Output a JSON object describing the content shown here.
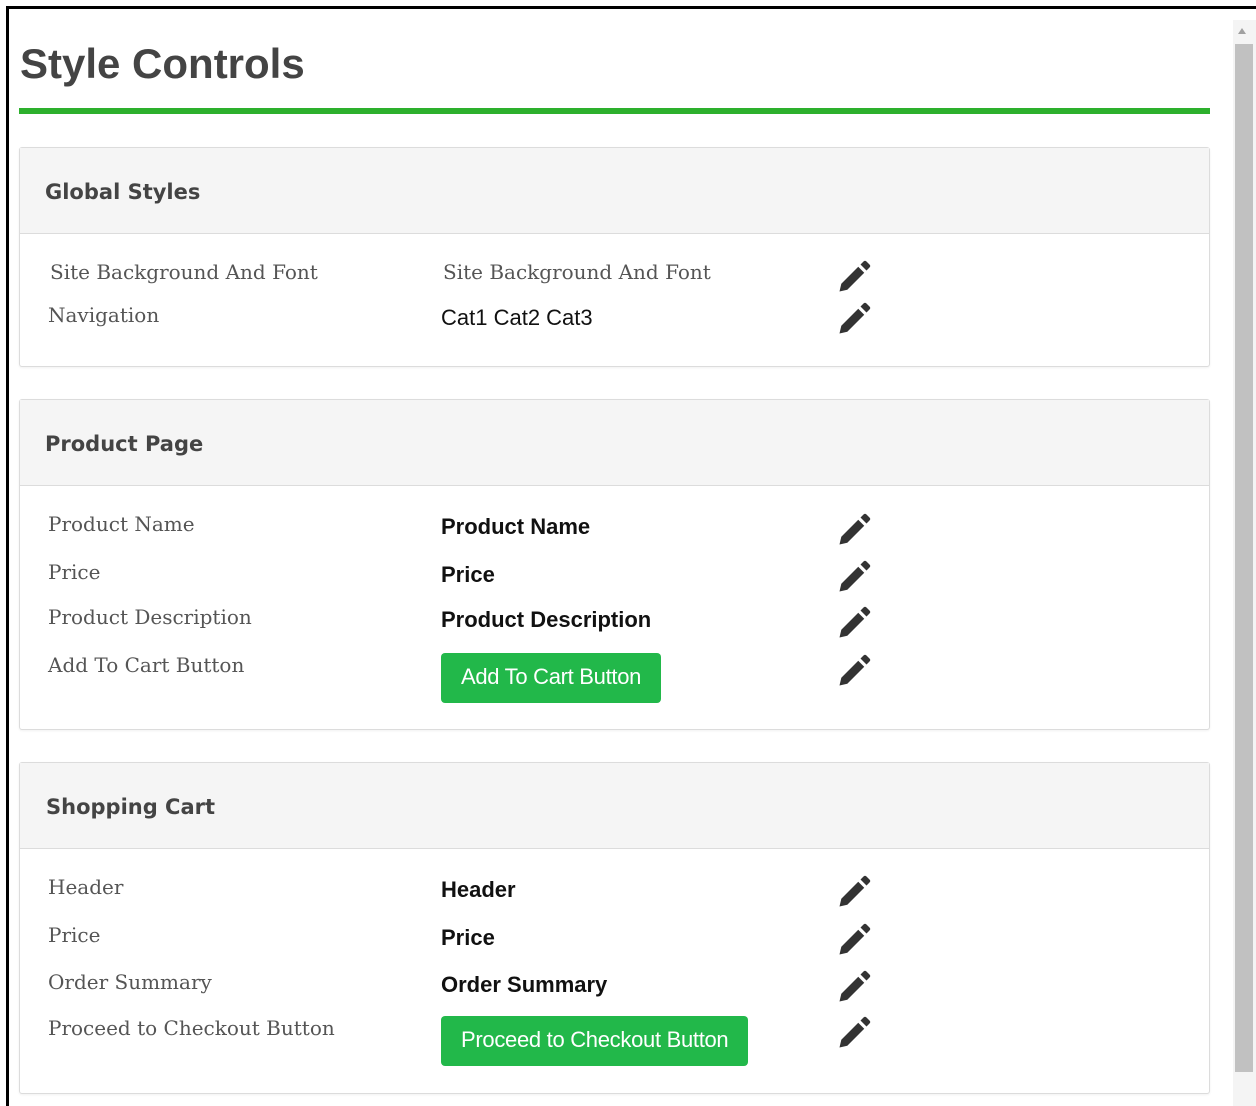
{
  "page_title": "Style Controls",
  "colors": {
    "accent_rule": "#2db02d",
    "button_green": "#22b84a",
    "panel_header_bg": "#f5f5f5"
  },
  "sections": [
    {
      "title": "Global Styles",
      "rows": [
        {
          "label": "Site Background And Font",
          "preview": "Site Background And Font",
          "preview_style": "serif",
          "icon": "pencil-icon"
        },
        {
          "label": "Navigation",
          "preview": "Cat1 Cat2 Cat3",
          "preview_style": "plain",
          "icon": "pencil-icon"
        }
      ]
    },
    {
      "title": "Product Page",
      "rows": [
        {
          "label": "Product Name",
          "preview": "Product Name",
          "preview_style": "bold",
          "icon": "pencil-icon"
        },
        {
          "label": "Price",
          "preview": "Price",
          "preview_style": "bold",
          "icon": "pencil-icon"
        },
        {
          "label": "Product Description",
          "preview": "Product Description",
          "preview_style": "bold",
          "icon": "pencil-icon"
        },
        {
          "label": "Add To Cart Button",
          "preview": "Add To Cart Button",
          "preview_style": "button",
          "icon": "pencil-icon"
        }
      ]
    },
    {
      "title": "Shopping Cart",
      "rows": [
        {
          "label": "Header",
          "preview": "Header",
          "preview_style": "bold",
          "icon": "pencil-icon"
        },
        {
          "label": "Price",
          "preview": "Price",
          "preview_style": "bold",
          "icon": "pencil-icon"
        },
        {
          "label": "Order Summary",
          "preview": "Order Summary",
          "preview_style": "bold",
          "icon": "pencil-icon"
        },
        {
          "label": "Proceed to Checkout Button",
          "preview": "Proceed to Checkout Button",
          "preview_style": "button",
          "icon": "pencil-icon"
        }
      ]
    }
  ]
}
